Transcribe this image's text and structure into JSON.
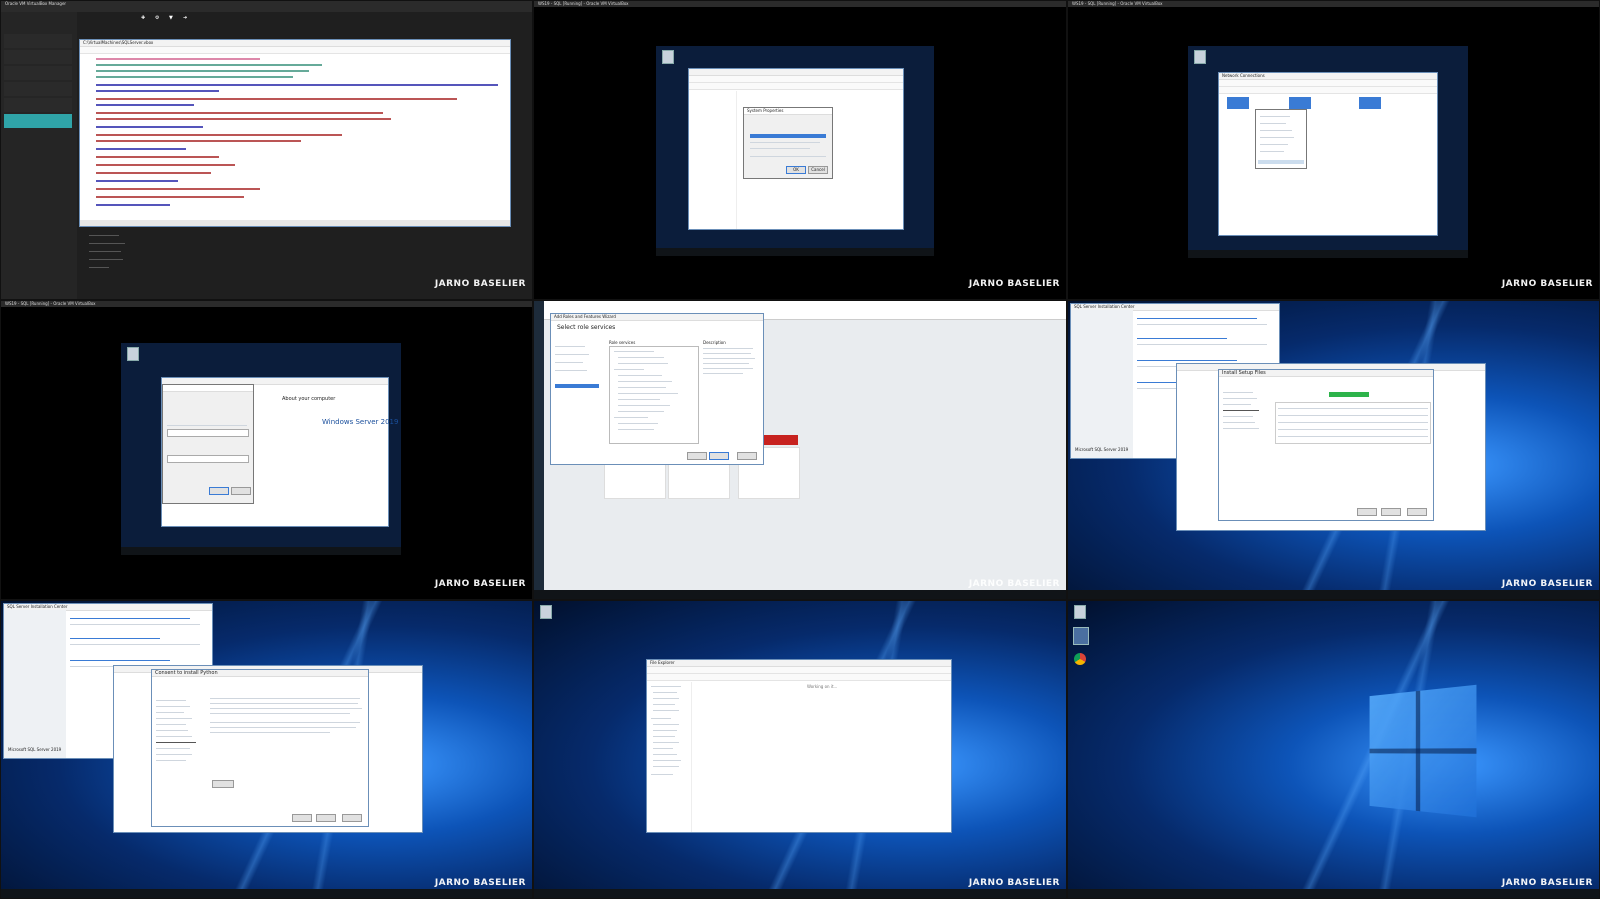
{
  "watermark": {
    "name": "JARNO BASELIER"
  },
  "cells": {
    "c1": {
      "host_title": "Oracle VM VirtualBox Manager",
      "editor_title": "C:\\VirtualMachines\\SQLServer.vbox",
      "tool_labels": [
        "New",
        "Settings",
        "Discard",
        "Show"
      ],
      "status": "Windows Server 2019"
    },
    "c2": {
      "vm_title": "WS19 - SQL [Running] - Oracle VM VirtualBox",
      "dialog_title": "System Properties",
      "ok_label": "OK",
      "cancel_label": "Cancel"
    },
    "c3": {
      "vm_title": "WS19 - SQL [Running] - Oracle VM VirtualBox",
      "window_title": "Network Connections"
    },
    "c4": {
      "vm_title": "WS19 - SQL [Running] - Oracle VM VirtualBox",
      "os_label": "Windows Server 2019",
      "about_label": "About your computer"
    },
    "c5": {
      "window_title": "Add Roles and Features Wizard",
      "heading": "Select role services",
      "col_role": "Role services",
      "col_desc": "Description"
    },
    "c6": {
      "center_title": "SQL Server Installation Center",
      "dialog_title": "Install Setup Files",
      "sidebar_footer": "Microsoft SQL Server 2019"
    },
    "c7": {
      "center_title": "SQL Server Installation Center",
      "dialog_title": "Consent to install Python",
      "sidebar_footer": "Microsoft SQL Server 2019"
    },
    "c8": {
      "window_title": "File Explorer",
      "status": "Working on it..."
    },
    "c9": {}
  }
}
